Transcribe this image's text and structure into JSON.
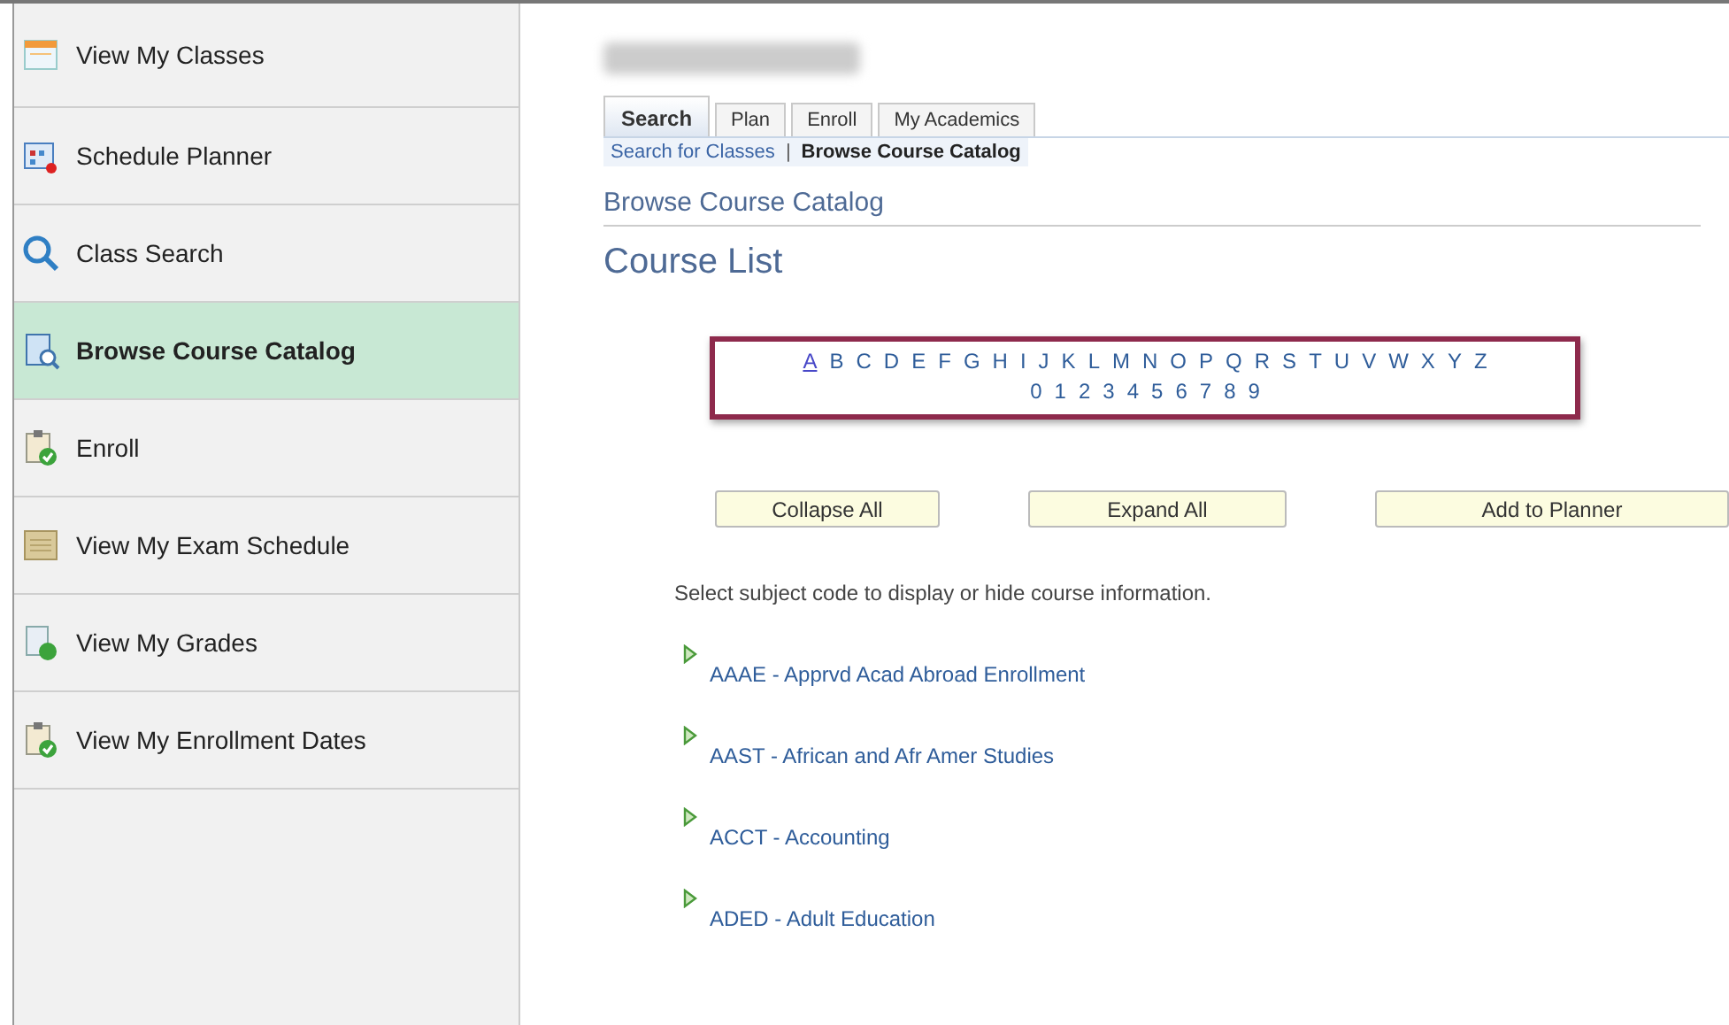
{
  "sidebar": {
    "items": [
      {
        "label": "View My Classes",
        "kind": "calendar",
        "selected": false
      },
      {
        "label": "Schedule Planner",
        "kind": "planner",
        "selected": false
      },
      {
        "label": "Class Search",
        "kind": "search",
        "selected": false
      },
      {
        "label": "Browse Course Catalog",
        "kind": "catalog",
        "selected": true
      },
      {
        "label": "Enroll",
        "kind": "enroll",
        "selected": false
      },
      {
        "label": "View My Exam Schedule",
        "kind": "exam",
        "selected": false
      },
      {
        "label": "View My Grades",
        "kind": "grades",
        "selected": false
      },
      {
        "label": "View My Enrollment Dates",
        "kind": "enroll",
        "selected": false
      }
    ]
  },
  "tabs": [
    {
      "label": "Search",
      "selected": true
    },
    {
      "label": "Plan",
      "selected": false
    },
    {
      "label": "Enroll",
      "selected": false
    },
    {
      "label": "My Academics",
      "selected": false
    }
  ],
  "subnav": [
    {
      "label": "Search for Classes",
      "selected": false
    },
    {
      "label": "Browse Course Catalog",
      "selected": true
    }
  ],
  "subnav_separator": "|",
  "page_title": "Browse Course Catalog",
  "section_title": "Course List",
  "letters": [
    {
      "label": "A",
      "selected": true
    },
    {
      "label": "B",
      "selected": false
    },
    {
      "label": "C",
      "selected": false
    },
    {
      "label": "D",
      "selected": false
    },
    {
      "label": "E",
      "selected": false
    },
    {
      "label": "F",
      "selected": false
    },
    {
      "label": "G",
      "selected": false
    },
    {
      "label": "H",
      "selected": false
    },
    {
      "label": "I",
      "selected": false
    },
    {
      "label": "J",
      "selected": false
    },
    {
      "label": "K",
      "selected": false
    },
    {
      "label": "L",
      "selected": false
    },
    {
      "label": "M",
      "selected": false
    },
    {
      "label": "N",
      "selected": false
    },
    {
      "label": "O",
      "selected": false
    },
    {
      "label": "P",
      "selected": false
    },
    {
      "label": "Q",
      "selected": false
    },
    {
      "label": "R",
      "selected": false
    },
    {
      "label": "S",
      "selected": false
    },
    {
      "label": "T",
      "selected": false
    },
    {
      "label": "U",
      "selected": false
    },
    {
      "label": "V",
      "selected": false
    },
    {
      "label": "W",
      "selected": false
    },
    {
      "label": "X",
      "selected": false
    },
    {
      "label": "Y",
      "selected": false
    },
    {
      "label": "Z",
      "selected": false
    }
  ],
  "digits": [
    {
      "label": "0",
      "selected": false
    },
    {
      "label": "1",
      "selected": false
    },
    {
      "label": "2",
      "selected": false
    },
    {
      "label": "3",
      "selected": false
    },
    {
      "label": "4",
      "selected": false
    },
    {
      "label": "5",
      "selected": false
    },
    {
      "label": "6",
      "selected": false
    },
    {
      "label": "7",
      "selected": false
    },
    {
      "label": "8",
      "selected": false
    },
    {
      "label": "9",
      "selected": false
    }
  ],
  "buttons": [
    "Collapse All",
    "Expand All",
    "Add to Planner"
  ],
  "instruction": "Select subject code to display or hide course information.",
  "courses": [
    {
      "label": "AAAE - Apprvd Acad Abroad Enrollment",
      "expanded": false
    },
    {
      "label": "AAST - African and Afr Amer Studies",
      "expanded": false
    },
    {
      "label": "ACCT - Accounting",
      "expanded": false
    },
    {
      "label": "ADED - Adult Education",
      "expanded": false
    }
  ]
}
